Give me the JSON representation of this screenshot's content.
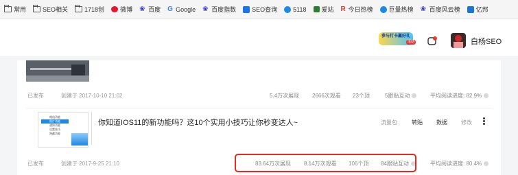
{
  "bookmarks": [
    {
      "label": "常用",
      "icon": "folder-icon",
      "color": "#555555"
    },
    {
      "label": "SEO相关",
      "icon": "folder-icon",
      "color": "#555555"
    },
    {
      "label": "1718创",
      "icon": "folder-icon",
      "color": "#555555"
    },
    {
      "label": "微博",
      "icon": "weibo-icon",
      "color": "#e6162d"
    },
    {
      "label": "百度",
      "icon": "baidu-paw-icon",
      "color": "#2932e1"
    },
    {
      "label": "Google",
      "icon": "google-icon",
      "color": "#4285f4"
    },
    {
      "label": "百度指数",
      "icon": "baidu-paw-icon",
      "color": "#2932e1"
    },
    {
      "label": "SEO查询",
      "icon": "seo-query-icon",
      "color": "#1a73e8"
    },
    {
      "label": "5118",
      "icon": "5118-icon",
      "color": "#1e88e5"
    },
    {
      "label": "爱站",
      "icon": "aizhan-icon",
      "color": "#2e7d32"
    },
    {
      "label": "今日热榜",
      "icon": "hot-list-icon",
      "color": "#e53935"
    },
    {
      "label": "巨量热榜",
      "icon": "juliang-icon",
      "color": "#1e88e5"
    },
    {
      "label": "百度风云榜",
      "icon": "baidu-paw-icon",
      "color": "#2932e1"
    },
    {
      "label": "亿邦",
      "icon": "yibang-icon",
      "color": "#1976d2"
    }
  ],
  "header": {
    "promo_text": "参与打卡赢好礼",
    "promo_badge": "活动",
    "username": "白杨SEO"
  },
  "articles": [
    {
      "status": "已发布",
      "created": "创建于 2017-10-10 21:02",
      "impressions": "5.4万次展现",
      "views": "2666次观看",
      "likes": "23个顶",
      "interactions": "5跟贴互动",
      "read_progress": "平均阅读进度: 82.9%"
    },
    {
      "title": "你知道IOS11的新功能吗？这10个实用小技巧让你秒变达人~",
      "status": "已发布",
      "created": "创建于 2017-9-25 21:10",
      "impressions": "83.64万次展现",
      "views": "8.14万次观看",
      "likes": "106个顶",
      "interactions": "84跟贴互动",
      "read_progress": "平均阅读进度: 80.4%",
      "actions": {
        "traffic": "流量包",
        "repost": "转贴",
        "data": "数据",
        "edit": "修改"
      },
      "thumb_lines": [
        "相机功能",
        "照片功能",
        "通知功能",
        "设置技巧",
        "隐藏功能"
      ]
    }
  ],
  "colors": {
    "highlight": "#e6281e",
    "accent": "#e64a19",
    "muted": "#9a9a9a"
  }
}
